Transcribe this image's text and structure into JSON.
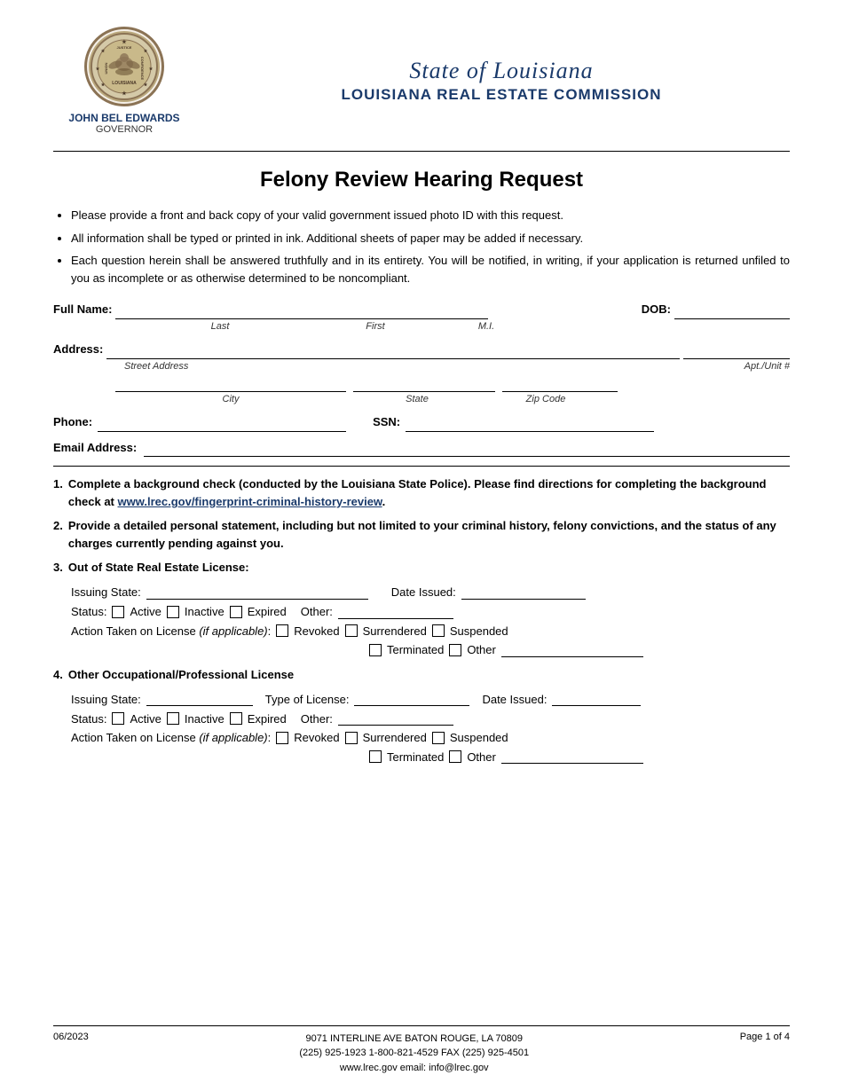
{
  "header": {
    "governor_name": "JOHN BEL EDWARDS",
    "governor_title": "GOVERNOR",
    "state_title": "State of Louisiana",
    "commission_title": "LOUISIANA REAL ESTATE COMMISSION",
    "logo_text": "STATE OF LOUISIANA"
  },
  "form": {
    "title": "Felony Review Hearing Request",
    "instructions": [
      "Please provide a front and back copy of your valid government issued photo ID with this request.",
      "All information shall be typed or printed in ink. Additional sheets of paper may be added if necessary.",
      "Each question herein shall be answered truthfully and in its entirety. You will be notified, in writing, if your application is returned unfiled to you as incomplete or as otherwise determined to be noncompliant."
    ]
  },
  "fields": {
    "full_name_label": "Full Name:",
    "last_label": "Last",
    "first_label": "First",
    "mi_label": "M.I.",
    "dob_label": "DOB:",
    "address_label": "Address:",
    "street_address_label": "Street Address",
    "apt_unit_label": "Apt./Unit #",
    "city_label": "City",
    "state_label": "State",
    "zip_code_label": "Zip Code",
    "phone_label": "Phone:",
    "ssn_label": "SSN:",
    "email_label": "Email Address:"
  },
  "sections": [
    {
      "num": "1.",
      "text": "Complete a background check (conducted by the Louisiana State Police). Please find directions for completing the background check at ",
      "link": "www.lrec.gov/fingerprint-criminal-history-review",
      "text_after": "."
    },
    {
      "num": "2.",
      "text": "Provide a detailed personal statement, including but not limited to your criminal history, felony convictions, and the status of any charges currently pending against you."
    },
    {
      "num": "3.",
      "text": "Out of State Real Estate License:"
    },
    {
      "num": "4.",
      "text": "Other Occupational/Professional License"
    }
  ],
  "license_section_3": {
    "issuing_state_label": "Issuing State:",
    "date_issued_label": "Date Issued:",
    "status_label": "Status:",
    "active_label": "Active",
    "inactive_label": "Inactive",
    "expired_label": "Expired",
    "other_label": "Other:",
    "action_label": "Action Taken on License",
    "if_applicable": "(if applicable):",
    "revoked_label": "Revoked",
    "surrendered_label": "Surrendered",
    "suspended_label": "Suspended",
    "terminated_label": "Terminated",
    "other2_label": "Other"
  },
  "license_section_4": {
    "issuing_state_label": "Issuing  State:",
    "type_of_license_label": "Type of License:",
    "date_issued_label": "Date Issued:",
    "status_label": "Status:",
    "active_label": "Active",
    "inactive_label": "Inactive",
    "expired_label": "Expired",
    "other_label": "Other:",
    "action_label": "Action Taken on License",
    "if_applicable": "(if applicable):",
    "revoked_label": "Revoked",
    "surrendered_label": "Surrendered",
    "suspended_label": "Suspended",
    "terminated_label": "Terminated",
    "other2_label": "Other"
  },
  "footer": {
    "date": "06/2023",
    "address": "9071 INTERLINE AVE    BATON ROUGE, LA 70809",
    "phone": "(225) 925-1923   1-800-821-4529   FAX (225) 925-4501",
    "website": "www.lrec.gov   email: info@lrec.gov",
    "page": "Page 1 of 4"
  }
}
